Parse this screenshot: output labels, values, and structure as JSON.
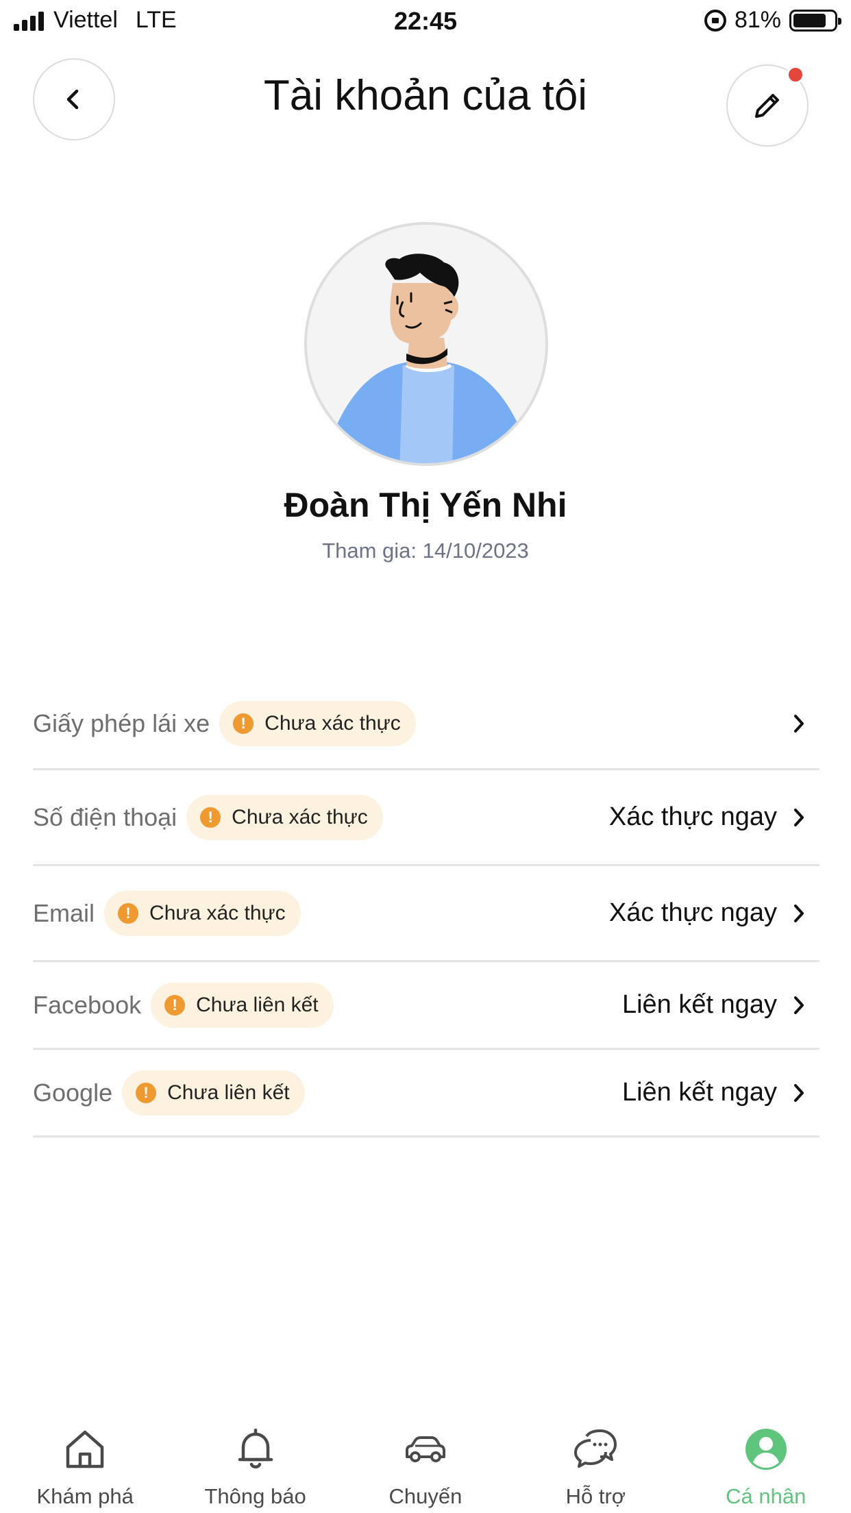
{
  "status_bar": {
    "carrier": "Viettel",
    "network": "LTE",
    "time": "22:45",
    "battery": "81%",
    "battery_level": 0.81
  },
  "header": {
    "title": "Tài khoản của tôi",
    "back_icon": "chevron-left-icon",
    "edit_icon": "pencil-icon",
    "notification_dot_color": "#e5463b"
  },
  "profile": {
    "name": "Đoàn Thị Yến Nhi",
    "joined": "Tham gia: 14/10/2023"
  },
  "verification": {
    "items": [
      {
        "label": "Giấy phép lái xe",
        "status": "Chưa xác thực",
        "action": ""
      },
      {
        "label": "Số điện thoại",
        "status": "Chưa xác thực",
        "action": "Xác thực ngay"
      },
      {
        "label": "Email",
        "status": "Chưa xác thực",
        "action": "Xác thực ngay"
      },
      {
        "label": "Facebook",
        "status": "Chưa liên kết",
        "action": "Liên kết ngay"
      },
      {
        "label": "Google",
        "status": "Chưa liên kết",
        "action": "Liên kết ngay"
      }
    ],
    "status_icon": "!",
    "status_icon_color": "#ef9a30",
    "badge_bg": "#fdf1e0"
  },
  "bottom_nav": {
    "items": [
      {
        "label": "Khám phá",
        "icon": "home-icon"
      },
      {
        "label": "Thông báo",
        "icon": "bell-icon"
      },
      {
        "label": "Chuyến",
        "icon": "car-icon"
      },
      {
        "label": "Hỗ trợ",
        "icon": "chat-icon"
      },
      {
        "label": "Cá nhân",
        "icon": "user-icon"
      }
    ],
    "active": "Cá nhân",
    "active_color": "#5fc57d"
  }
}
